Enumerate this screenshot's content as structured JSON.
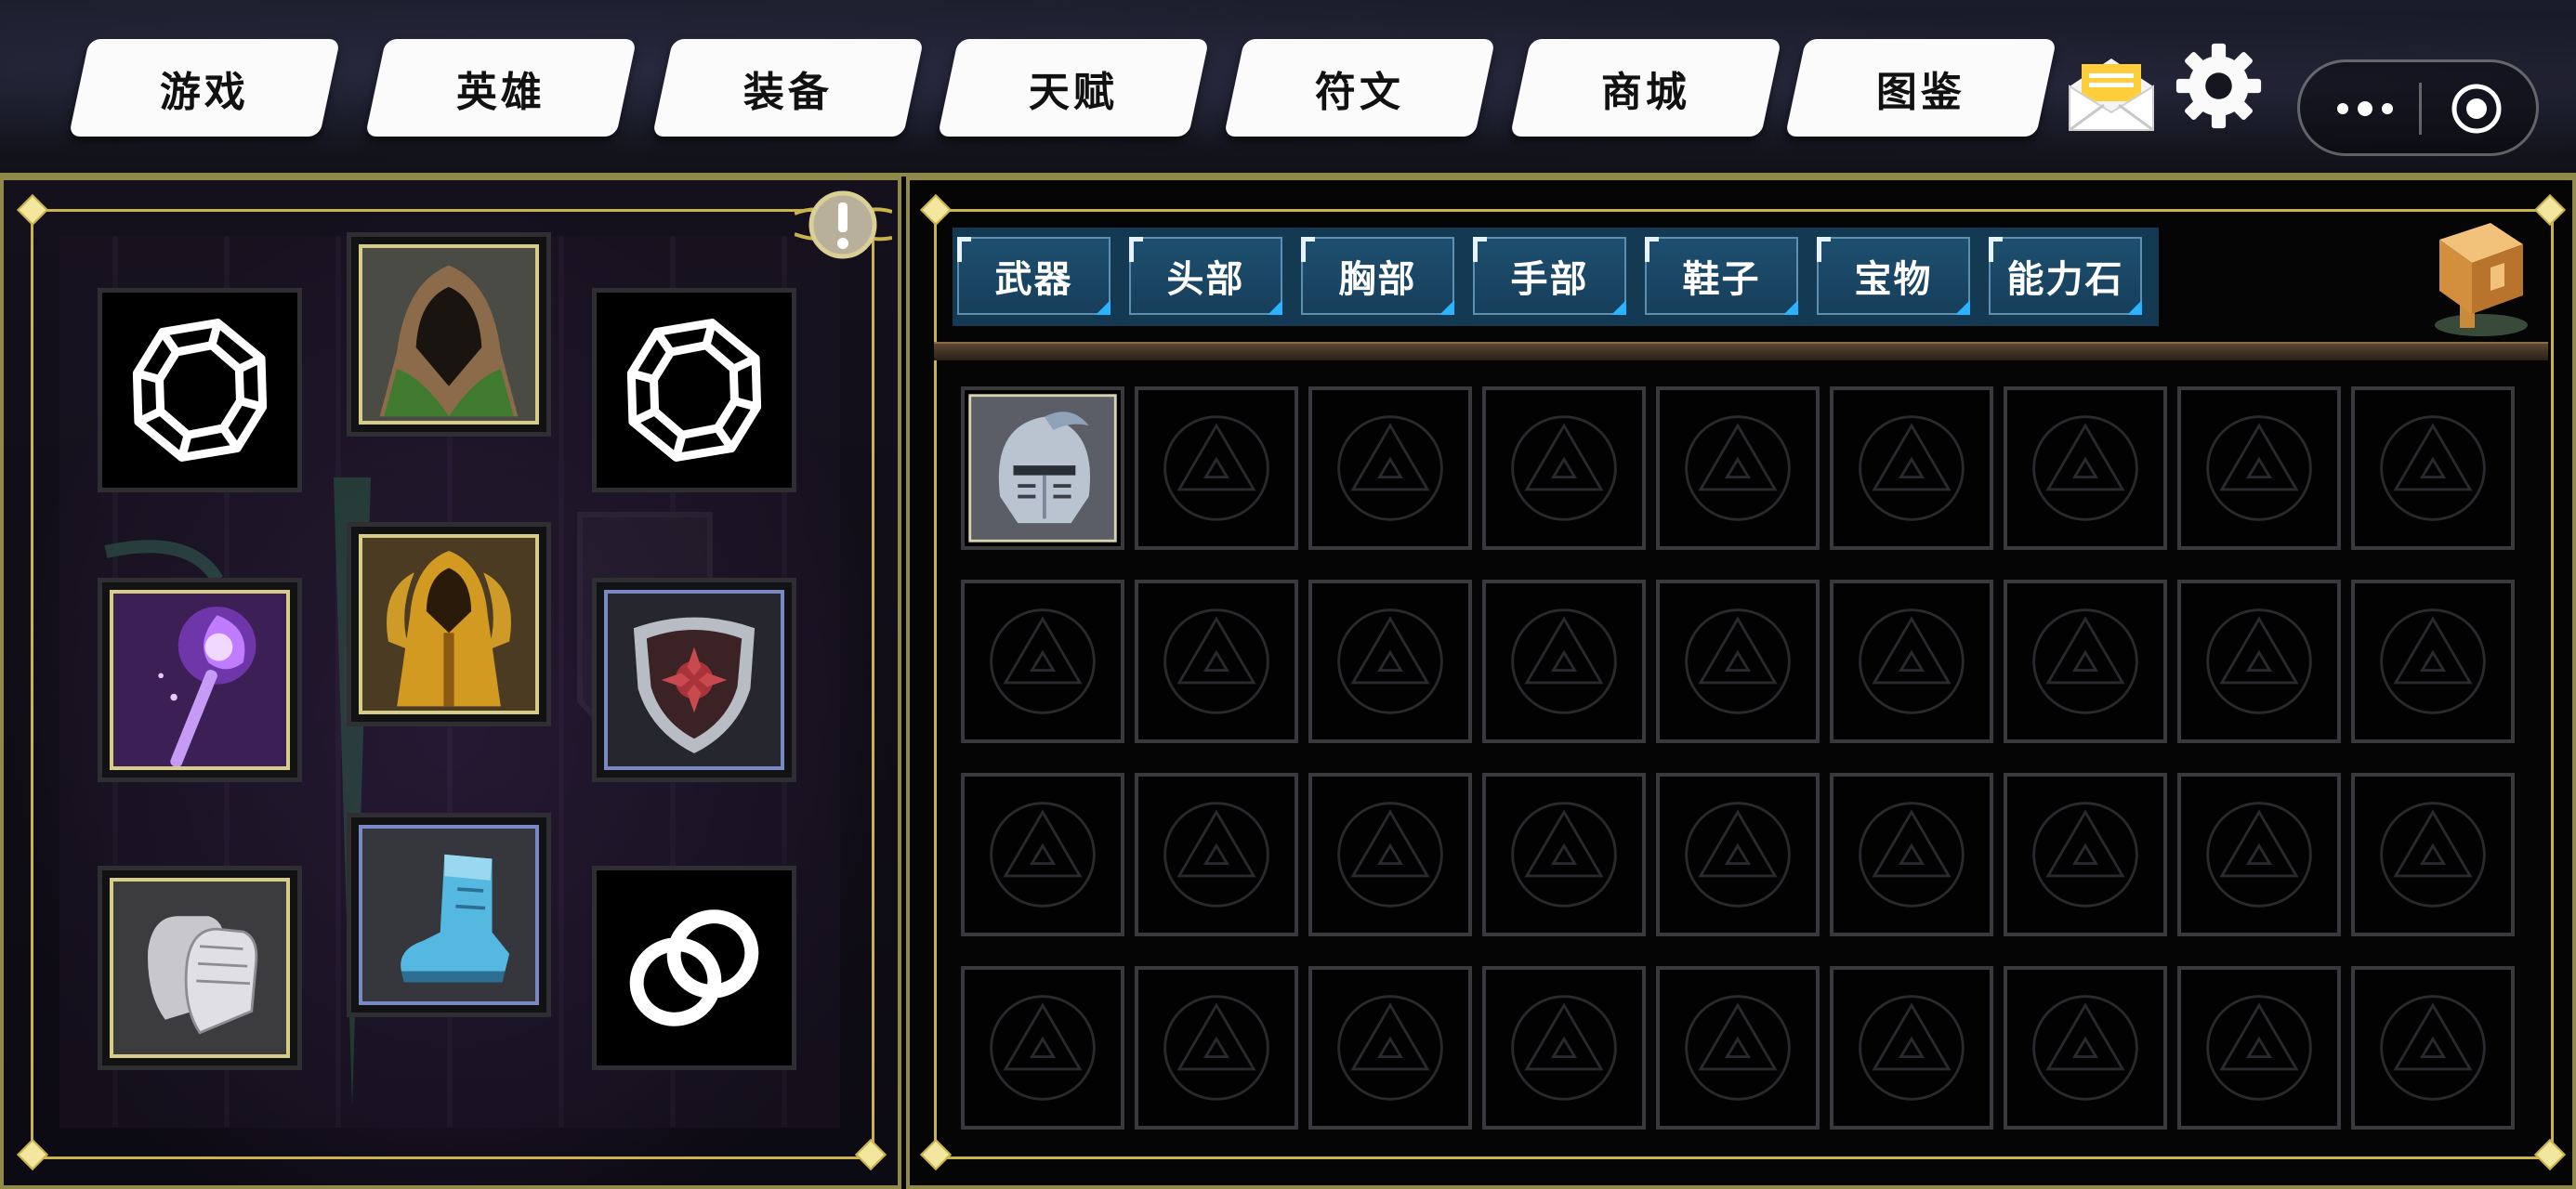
{
  "nav": {
    "tabs": [
      "游戏",
      "英雄",
      "装备",
      "天赋",
      "符文",
      "商城",
      "图鉴"
    ]
  },
  "categories": {
    "tabs": [
      "武器",
      "头部",
      "胸部",
      "手部",
      "鞋子",
      "宝物",
      "能力石"
    ]
  },
  "equipment": {
    "slots": [
      {
        "name": "gem-slot-left",
        "icon": "gem-outline-icon",
        "filled": false
      },
      {
        "name": "hood-slot",
        "icon": "green-hood-icon",
        "filled": true
      },
      {
        "name": "gem-slot-right",
        "icon": "gem-outline-icon",
        "filled": false
      },
      {
        "name": "staff-slot",
        "icon": "purple-staff-icon",
        "filled": true
      },
      {
        "name": "robe-slot",
        "icon": "golden-robe-icon",
        "filled": true
      },
      {
        "name": "shield-slot",
        "icon": "shield-icon",
        "filled": true
      },
      {
        "name": "gloves-slot",
        "icon": "gauntlets-icon",
        "filled": true
      },
      {
        "name": "boots-slot",
        "icon": "blue-boots-icon",
        "filled": true
      },
      {
        "name": "ring-slot",
        "icon": "rings-outline-icon",
        "filled": false
      }
    ]
  },
  "inventory": {
    "rows": 4,
    "cols": 9,
    "items": [
      {
        "row": 0,
        "col": 0,
        "icon": "knight-helmet-icon"
      }
    ]
  },
  "icons": [
    "mail-icon",
    "gear-icon",
    "more-icon",
    "target-icon",
    "alert-icon",
    "box-icon"
  ],
  "colors": {
    "frame_gold": "#c9b34a",
    "tab_blue": "#1e4f6f",
    "accent_cyan": "#2bb3ff"
  }
}
